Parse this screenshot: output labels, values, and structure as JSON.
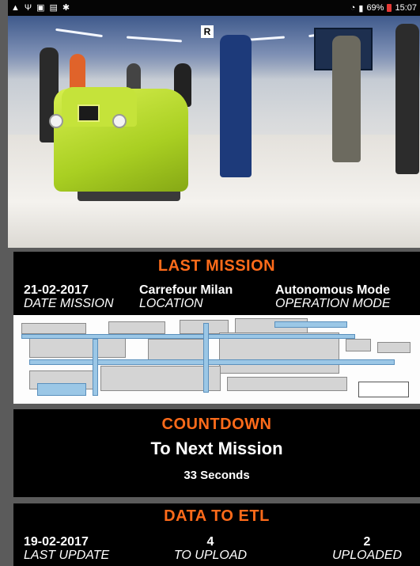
{
  "statusbar": {
    "left_icons": [
      "warning-icon",
      "usb-icon",
      "gallery-icon",
      "file-icon",
      "settings-icon"
    ],
    "battery": "69%",
    "time": "15:07"
  },
  "hero": {
    "sign_letter": "R"
  },
  "last_mission": {
    "title": "LAST MISSION",
    "date": "21-02-2017",
    "date_label": "DATE MISSION",
    "location": "Carrefour Milan",
    "location_label": "LOCATION",
    "mode": "Autonomous Mode",
    "mode_label": "OPERATION MODE"
  },
  "countdown": {
    "title": "COUNTDOWN",
    "subtitle": "To Next Mission",
    "seconds": "33 Seconds"
  },
  "etl": {
    "title": "DATA TO ETL",
    "last_update": "19-02-2017",
    "last_update_label": "LAST UPDATE",
    "to_upload": "4",
    "to_upload_label": "TO UPLOAD",
    "uploaded": "2",
    "uploaded_label": "UPLOADED"
  },
  "colors": {
    "accent": "#ff6b1a",
    "panel": "#000000",
    "background": "#5b5b5b"
  }
}
